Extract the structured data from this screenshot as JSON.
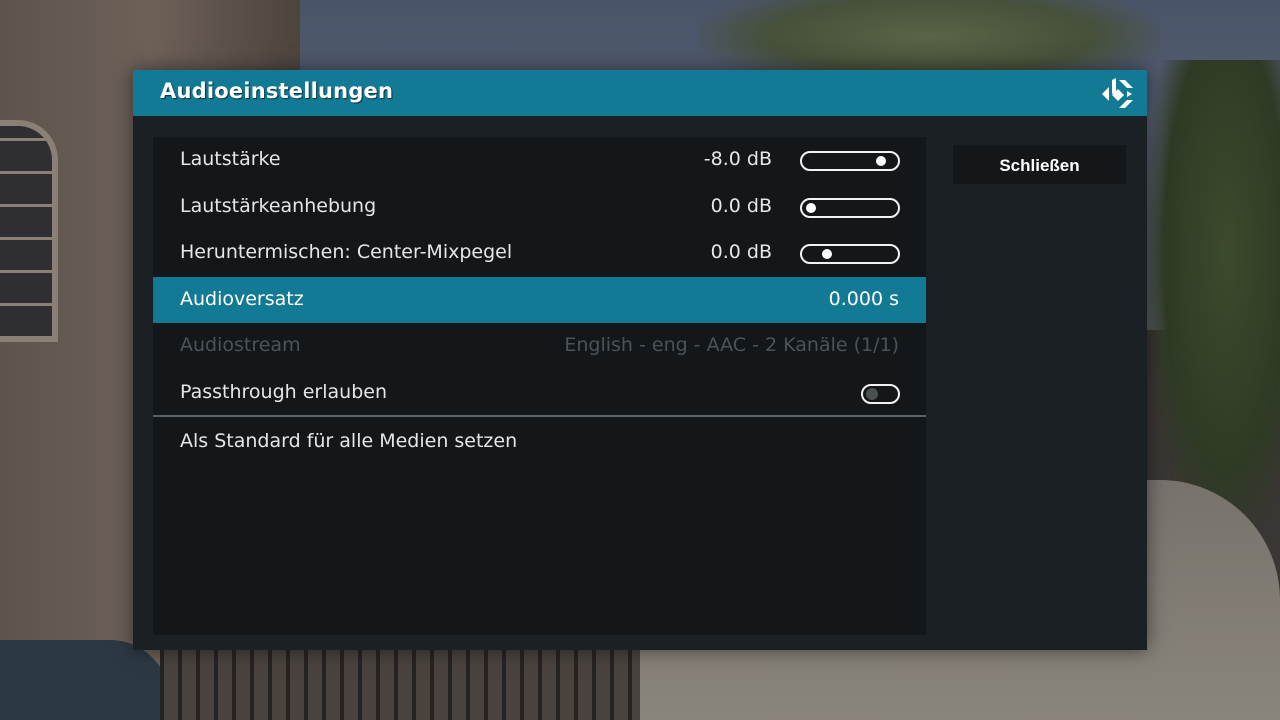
{
  "dialog": {
    "title": "Audioeinstellungen",
    "accent_color": "#137a95",
    "logo_icon": "kodi-logo-icon"
  },
  "settings": [
    {
      "label": "Lautstärke",
      "value": "-8.0 dB",
      "control": "slider",
      "level": 0.9
    },
    {
      "label": "Lautstärkeanhebung",
      "value": "0.0 dB",
      "control": "slider",
      "level": 0.0
    },
    {
      "label": "Heruntermischen: Center-Mixpegel",
      "value": "0.0 dB",
      "control": "slider",
      "level": 0.2
    },
    {
      "label": "Audioversatz",
      "value": "0.000 s",
      "control": "none",
      "focused": true
    },
    {
      "label": "Audiostream",
      "value": "English - eng - AAC  - 2 Kanäle (1/1)",
      "control": "none",
      "disabled": true
    },
    {
      "label": "Passthrough erlauben",
      "control": "toggle",
      "enabled": false
    }
  ],
  "default_action": {
    "label": "Als Standard für alle Medien setzen"
  },
  "side": {
    "close_label": "Schließen"
  }
}
